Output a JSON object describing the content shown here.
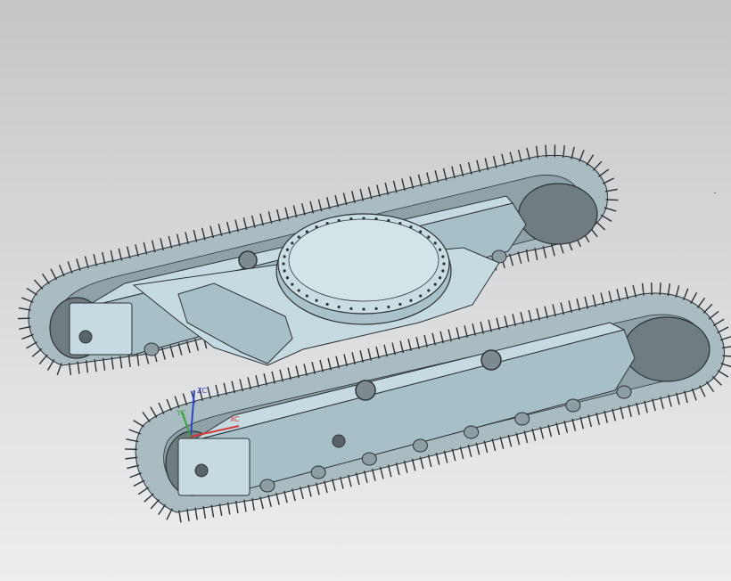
{
  "viewport": {
    "background_top": "#c4c6c8",
    "background_bottom": "#eceeef"
  },
  "model": {
    "body_color": "#c5dbe1",
    "body_shadow_color": "#a7c0c7",
    "edge_color": "#2c3236",
    "track_link_color": "#a9bcc2",
    "sprocket_color": "#6f7c80",
    "swing_bearing_color": "#c9dde2"
  },
  "triad": {
    "x_axis_color": "#d23a3a",
    "y_axis_color": "#3aa23a",
    "z_axis_color": "#2f45c8",
    "x_label": "XC",
    "y_label": "YC",
    "z_label": "ZC"
  }
}
